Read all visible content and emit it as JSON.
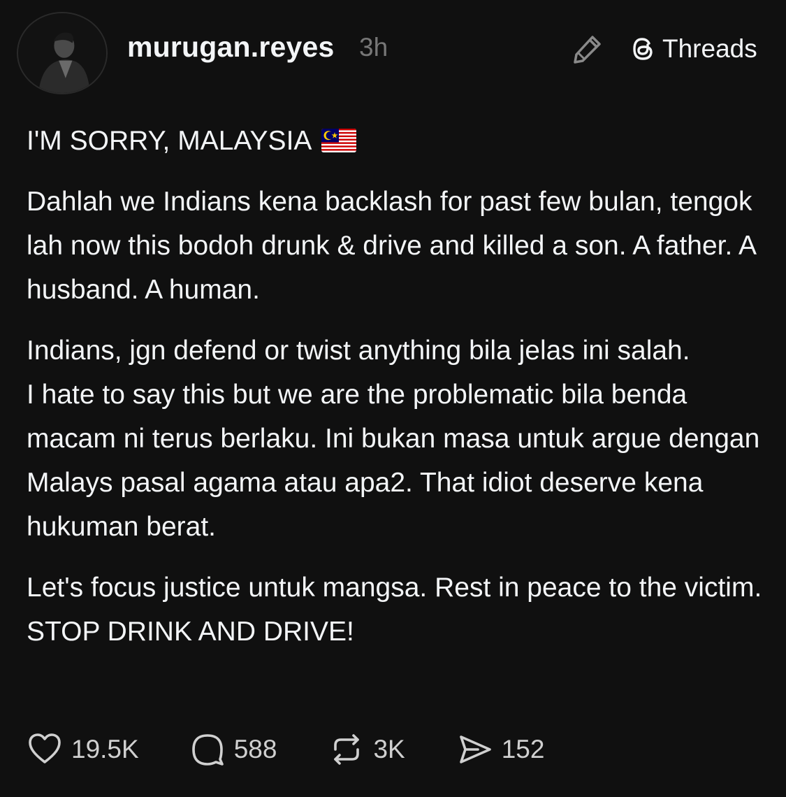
{
  "header": {
    "username": "murugan.reyes",
    "time": "3h",
    "brand_label": "Threads",
    "avatar_icon": "profile-photo",
    "edit_icon": "pencil-icon",
    "brand_icon": "threads-logo-icon"
  },
  "post": {
    "title": "I'M SORRY, MALAYSIA",
    "title_emoji": "malaysia-flag",
    "paragraphs": [
      "Dahlah we Indians kena backlash for past few bulan, tengok lah now this bodoh drunk & drive and killed a son. A father. A husband. A human.",
      "Indians, jgn defend or twist anything bila jelas ini salah.",
      "I hate to say this but we are the problematic bila benda macam ni terus berlaku. Ini bukan masa untuk argue dengan Malays pasal agama atau apa2. That idiot deserve kena hukuman berat.",
      "Let's focus justice untuk mangsa. Rest in peace to the victim. STOP DRINK AND DRIVE!"
    ]
  },
  "actions": {
    "likes": "19.5K",
    "comments": "588",
    "reposts": "3K",
    "shares": "152"
  },
  "colors": {
    "background": "#101010",
    "text": "#f3f5f7",
    "muted": "#777777"
  }
}
